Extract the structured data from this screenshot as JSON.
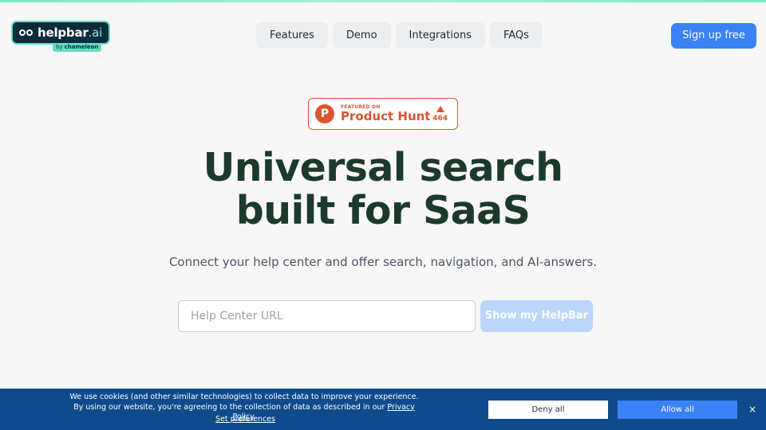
{
  "brand": {
    "name": "helpbar",
    "suffix": ".ai",
    "by": "by",
    "parent": "chameleon"
  },
  "nav": {
    "items": [
      "Features",
      "Demo",
      "Integrations",
      "FAQs"
    ]
  },
  "signup_label": "Sign up free",
  "product_hunt": {
    "letter": "P",
    "small": "FEATURED ON",
    "big": "Product Hunt",
    "votes": "464"
  },
  "hero": {
    "line1": "Universal search",
    "line2": "built for SaaS",
    "subtitle": "Connect your help center and offer search, navigation, and AI-answers."
  },
  "form": {
    "placeholder": "Help Center URL",
    "button": "Show my HelpBar"
  },
  "cookie": {
    "message_part1": "We use cookies (and other similar technologies) to collect data to improve your experience. By using our website, you're agreeing to the collection of data as described in our ",
    "privacy_link": "Privacy Policy",
    "message_part2": ".",
    "preferences": "Set preferences",
    "deny": "Deny all",
    "allow": "Allow all",
    "close": "×"
  },
  "colors": {
    "accent": "#3b82f6",
    "headline": "#1c3a2c",
    "banner": "#0f4b8c",
    "ph": "#da552f"
  }
}
